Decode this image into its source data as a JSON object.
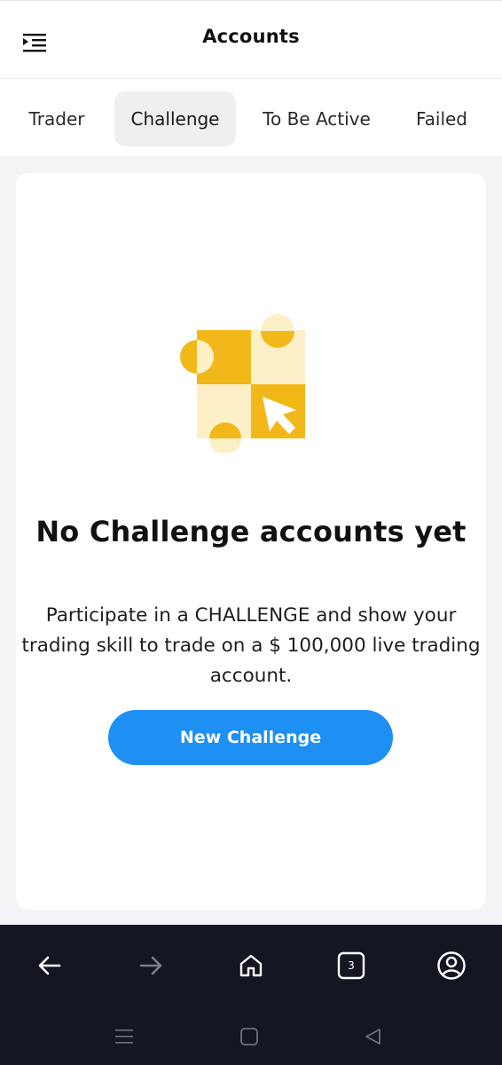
{
  "header": {
    "title": "Accounts",
    "menu_icon": "menu-collapse-icon"
  },
  "tabs": [
    {
      "label": "Trader",
      "active": false
    },
    {
      "label": "Challenge",
      "active": true
    },
    {
      "label": "To Be Active",
      "active": false
    },
    {
      "label": "Failed",
      "active": false
    }
  ],
  "empty_state": {
    "illustration": "checkerboard-cursor-illustration",
    "title": "No Challenge accounts yet",
    "description": "Participate in a CHALLENGE and show your trading skill to trade on a $ 100,000 live trading account.",
    "button_label": "New Challenge"
  },
  "browser_nav": {
    "tab_count": "3",
    "icons": [
      "back-arrow-icon",
      "forward-arrow-icon",
      "home-icon",
      "tabs-icon",
      "profile-icon"
    ]
  },
  "system_nav": {
    "icons": [
      "recents-icon",
      "home-square-icon",
      "back-triangle-icon"
    ]
  },
  "colors": {
    "accent": "#1e8ff3",
    "illustration_yellow": "#f2b81a",
    "illustration_light": "#fdefc6",
    "navbar_bg": "#141722"
  }
}
